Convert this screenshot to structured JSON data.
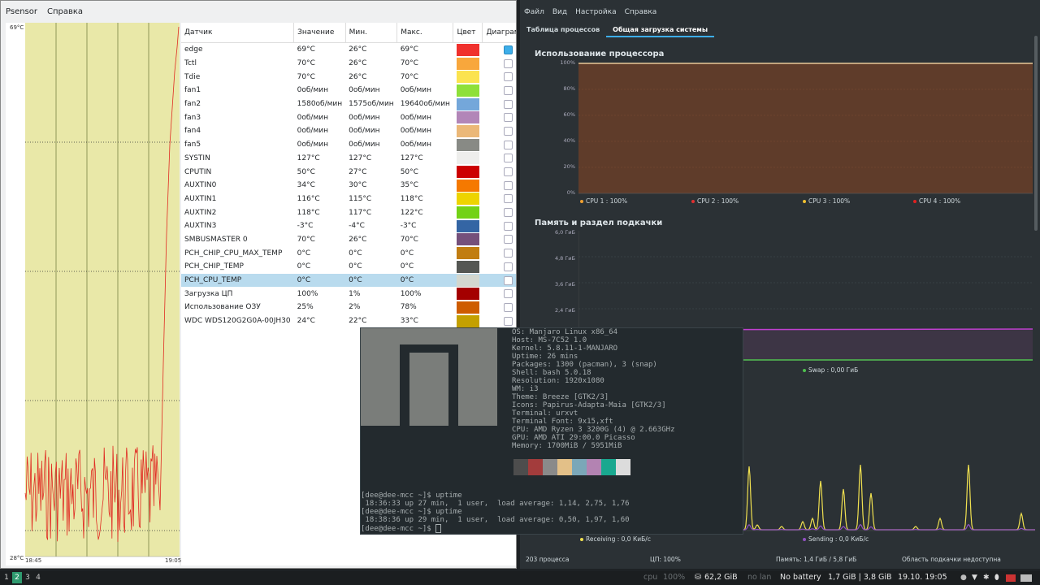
{
  "psensor": {
    "menu": [
      "Psensor",
      "Справка"
    ],
    "graph": {
      "y_max": "69°C",
      "y_min": "28°C",
      "x_start": "18:45",
      "x_end": "19:05"
    },
    "columns": [
      "Датчик",
      "Значение",
      "Мин.",
      "Макс.",
      "Цвет",
      "Диаграмма"
    ],
    "rows": [
      {
        "name": "edge",
        "value": "69°C",
        "min": "26°C",
        "max": "69°C",
        "color": "#f0312d",
        "checked": true
      },
      {
        "name": "Tctl",
        "value": "70°C",
        "min": "26°C",
        "max": "70°C",
        "color": "#f8a73c",
        "checked": false
      },
      {
        "name": "Tdie",
        "value": "70°C",
        "min": "26°C",
        "max": "70°C",
        "color": "#fbe34f",
        "checked": false
      },
      {
        "name": "fan1",
        "value": "0об/мин",
        "min": "0об/мин",
        "max": "0об/мин",
        "color": "#8ee03a",
        "checked": false
      },
      {
        "name": "fan2",
        "value": "1580об/мин",
        "min": "1575об/мин",
        "max": "19640об/мин",
        "color": "#74a7da",
        "checked": false
      },
      {
        "name": "fan3",
        "value": "0об/мин",
        "min": "0об/мин",
        "max": "0об/мин",
        "color": "#b286b8",
        "checked": false
      },
      {
        "name": "fan4",
        "value": "0об/мин",
        "min": "0об/мин",
        "max": "0об/мин",
        "color": "#ebb878",
        "checked": false
      },
      {
        "name": "fan5",
        "value": "0об/мин",
        "min": "0об/мин",
        "max": "0об/мин",
        "color": "#888a85",
        "checked": false
      },
      {
        "name": "SYSTIN",
        "value": "127°C",
        "min": "127°C",
        "max": "127°C",
        "color": "#eeeeec",
        "checked": false
      },
      {
        "name": "CPUTIN",
        "value": "50°C",
        "min": "27°C",
        "max": "50°C",
        "color": "#cc0000",
        "checked": false
      },
      {
        "name": "AUXTIN0",
        "value": "34°C",
        "min": "30°C",
        "max": "35°C",
        "color": "#f57900",
        "checked": false
      },
      {
        "name": "AUXTIN1",
        "value": "116°C",
        "min": "115°C",
        "max": "118°C",
        "color": "#edd400",
        "checked": false
      },
      {
        "name": "AUXTIN2",
        "value": "118°C",
        "min": "117°C",
        "max": "122°C",
        "color": "#73d216",
        "checked": false
      },
      {
        "name": "AUXTIN3",
        "value": "-3°C",
        "min": "-4°C",
        "max": "-3°C",
        "color": "#3465a4",
        "checked": false
      },
      {
        "name": "SMBUSMASTER 0",
        "value": "70°C",
        "min": "26°C",
        "max": "70°C",
        "color": "#75507b",
        "checked": false
      },
      {
        "name": "PCH_CHIP_CPU_MAX_TEMP",
        "value": "0°C",
        "min": "0°C",
        "max": "0°C",
        "color": "#c17d11",
        "checked": false
      },
      {
        "name": "PCH_CHIP_TEMP",
        "value": "0°C",
        "min": "0°C",
        "max": "0°C",
        "color": "#555753",
        "checked": false
      },
      {
        "name": "PCH_CPU_TEMP",
        "value": "0°C",
        "min": "0°C",
        "max": "0°C",
        "color": "#d3d7cf",
        "checked": false,
        "selected": true
      },
      {
        "name": "Загрузка ЦП",
        "value": "100%",
        "min": "1%",
        "max": "100%",
        "color": "#a40000",
        "checked": false
      },
      {
        "name": "Использование ОЗУ",
        "value": "25%",
        "min": "2%",
        "max": "78%",
        "color": "#ce5c00",
        "checked": false
      },
      {
        "name": "WDC WDS120G2G0A-00JH30",
        "value": "24°C",
        "min": "22°C",
        "max": "33°C",
        "color": "#c4a000",
        "checked": false
      }
    ]
  },
  "sysmon": {
    "menu": [
      "Файл",
      "Вид",
      "Настройка",
      "Справка"
    ],
    "tabs": [
      "Таблица процессов",
      "Общая загрузка системы"
    ],
    "cpu": {
      "title": "Использование процессора",
      "axis": [
        "100%",
        "80%",
        "60%",
        "40%",
        "20%",
        "0%"
      ],
      "legend": [
        {
          "label": "CPU 1 : 100%",
          "color": "#f0a030"
        },
        {
          "label": "CPU 2 : 100%",
          "color": "#e03030"
        },
        {
          "label": "CPU 3 : 100%",
          "color": "#f0c030"
        },
        {
          "label": "CPU 4 : 100%",
          "color": "#e02020"
        }
      ]
    },
    "mem": {
      "title": "Память и раздел подкачки",
      "axis": [
        "6,0 ГиБ",
        "4,8 ГиБ",
        "3,6 ГиБ",
        "2,4 ГиБ"
      ],
      "swap_label": "Swap : 0,00 ГиБ"
    },
    "net": {
      "receiving": "Receiving : 0,0 КиБ/с",
      "sending": "Sending : 0,0 КиБ/с"
    },
    "status": {
      "processes": "203 процесса",
      "cpu": "ЦП: 100%",
      "memory": "Память: 1,4 ГиБ / 5,8 ГиБ",
      "swap": "Область подкачки недоступна"
    }
  },
  "terminal": {
    "info": [
      "OS: Manjaro Linux x86_64",
      "Host: MS-7C52 1.0",
      "Kernel: 5.8.11-1-MANJARO",
      "Uptime: 26 mins",
      "Packages: 1300 (pacman), 3 (snap)",
      "Shell: bash 5.0.18",
      "Resolution: 1920x1080",
      "WM: i3",
      "Theme: Breeze [GTK2/3]",
      "Icons: Papirus-Adapta-Maia [GTK2/3]",
      "Terminal: urxvt",
      "Terminal Font: 9x15,xft",
      "CPU: AMD Ryzen 3 3200G (4) @ 2.663GHz",
      "GPU: AMD ATI 29:00.0 Picasso",
      "Memory: 1700MiB / 5951MiB"
    ],
    "palette": [
      "#4d4d4d",
      "#a33c3c",
      "#8a8a8a",
      "#e3c088",
      "#7ba7b8",
      "#b383b2",
      "#19a88f",
      "#dcdcdc"
    ],
    "lines": [
      "[dee@dee-mcc ~]$ uptime",
      " 18:36:33 up 27 min,  1 user,  load average: 1,14, 2,75, 1,76",
      "[dee@dee-mcc ~]$ uptime",
      " 18:38:36 up 29 min,  1 user,  load average: 0,50, 1,97, 1,60"
    ],
    "prompt": "[dee@dee-mcc ~]$ "
  },
  "bar": {
    "workspaces": [
      "1",
      "2",
      "3",
      "4"
    ],
    "active_workspace": "2",
    "cpu_label": "cpu",
    "cpu_value": "100%",
    "disk": "62,2 GiB",
    "lan": "no lan",
    "battery": "No battery",
    "mem": "1,7 GiB | 3,8 GiB",
    "datetime": "19.10. 19:05"
  }
}
